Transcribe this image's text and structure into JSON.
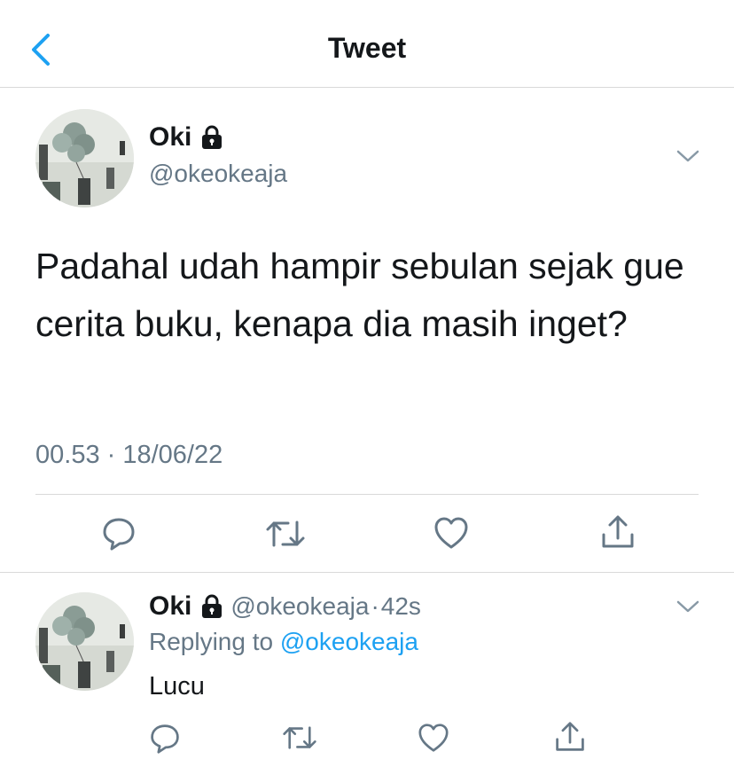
{
  "header": {
    "title": "Tweet"
  },
  "tweet": {
    "name": "Oki",
    "handle": "@okeokeaja",
    "text": "Padahal udah hampir sebulan sejak gue cerita buku, kenapa dia masih inget?",
    "time": "00.53",
    "date": "18/06/22",
    "meta_separator": " · "
  },
  "reply": {
    "name": "Oki",
    "handle": "@okeokeaja",
    "time_sep": "·",
    "time_ago": "42s",
    "replying_prefix": "Replying to ",
    "replying_to": "@okeokeaja",
    "text": "Lucu"
  },
  "icons": {
    "back": "chevron-left-icon",
    "lock": "lock-icon",
    "more": "chevron-down-icon",
    "reply": "reply-bubble-icon",
    "retweet": "retweet-icon",
    "like": "heart-icon",
    "share": "share-icon"
  },
  "colors": {
    "accent": "#1da1f2",
    "secondary_text": "#657786",
    "text": "#14171a",
    "action_icon": "#657786"
  }
}
